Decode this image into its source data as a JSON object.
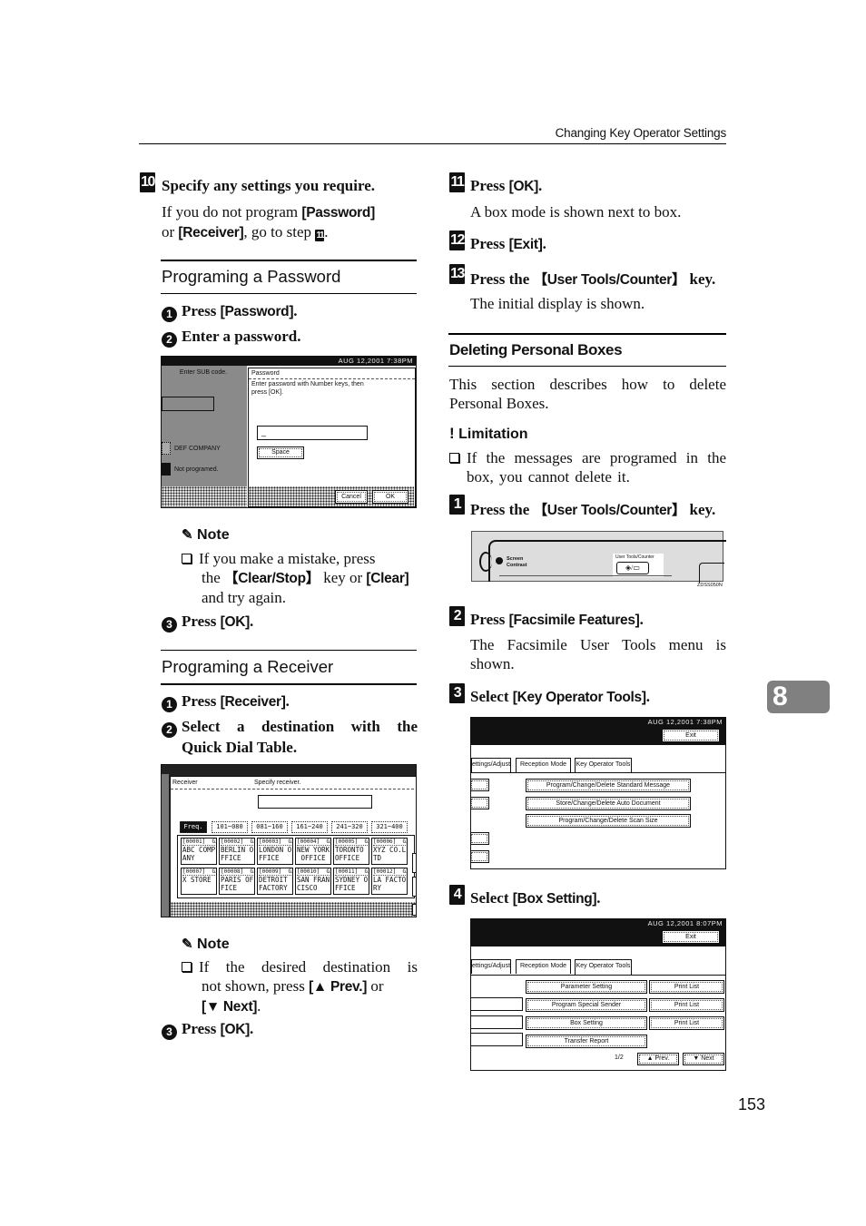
{
  "header": {
    "running_title": "Changing Key Operator Settings"
  },
  "left_column": {
    "step10": {
      "number": "10",
      "title": "Specify any settings you require.",
      "text_pre": "If you do not program ",
      "kw_password": "[Password]",
      "text_or": "or ",
      "kw_receiver": "[Receiver]",
      "text_post": ", go to step ",
      "step_ref": "11",
      "text_end": "."
    },
    "password_section": {
      "title": "Programing a Password",
      "sub1": {
        "num": "1",
        "pre": "Press ",
        "kw": "[Password]",
        "post": "."
      },
      "sub2": {
        "num": "2",
        "text": "Enter a password."
      },
      "screen": {
        "status": "AUG  12,2001  7:38PM",
        "left_label": "Enter SUB code.",
        "item1": "DEF COMPANY",
        "item2": "Not programed.",
        "dialog_title": "Password",
        "dialog_msg1": "Enter password with Number keys, then",
        "dialog_msg2": "press [OK].",
        "input_value": "_",
        "space_button": "Space",
        "cancel_button": "Cancel",
        "ok_button": "OK"
      },
      "note": {
        "title": "Note",
        "line1": "If you make a mistake, press",
        "line2_pre": "the ",
        "kw_clear_stop": "【Clear/Stop】",
        "line2_mid": " key or ",
        "kw_clear": "[Clear]",
        "line3": "and try again."
      },
      "sub3": {
        "num": "3",
        "pre": "Press ",
        "kw": "[OK]",
        "post": "."
      }
    },
    "receiver_section": {
      "title": "Programing a Receiver",
      "sub1": {
        "num": "1",
        "pre": "Press ",
        "kw": "[Receiver]",
        "post": "."
      },
      "sub2": {
        "num": "2",
        "line1": "Select a destination with the",
        "line2": "Quick Dial Table."
      },
      "screen": {
        "title": "Receiver",
        "instruction": "Specify receiver.",
        "tabs": [
          "Freq.",
          "101~080",
          "081~160",
          "161~240",
          "241~320",
          "321~400"
        ],
        "cells": [
          {
            "id": "[00001]  G3",
            "l1": "ABC COMP",
            "l2": "ANY"
          },
          {
            "id": "[00002]  G3",
            "l1": "BERLIN O",
            "l2": "FFICE"
          },
          {
            "id": "[00003]  G3",
            "l1": "LONDON O",
            "l2": "FFICE"
          },
          {
            "id": "[00004]  G3",
            "l1": "NEW YORK",
            "l2": " OFFICE"
          },
          {
            "id": "[00005]  G3",
            "l1": "TORONTO",
            "l2": "OFFICE"
          },
          {
            "id": "[00006]  G3",
            "l1": "XYZ CO.L",
            "l2": "TD"
          },
          {
            "id": "[00007]  G3",
            "l1": "X STORE",
            "l2": ""
          },
          {
            "id": "[00008]  G3",
            "l1": "PARIS OF",
            "l2": "FICE"
          },
          {
            "id": "[00009]  G3",
            "l1": "DETROIT",
            "l2": "FACTORY"
          },
          {
            "id": "[00010]  G3",
            "l1": "SAN FRAN",
            "l2": "CISCO"
          },
          {
            "id": "[00011]  G3",
            "l1": "SYDNEY O",
            "l2": "FFICE"
          },
          {
            "id": "[00012]  G3",
            "l1": "LA FACTO",
            "l2": "RY"
          }
        ]
      },
      "note": {
        "title": "Note",
        "line1": "If the desired destination is",
        "line2_pre": "not shown, press ",
        "kw_prev": "[▲ Prev.]",
        "line2_post": " or",
        "kw_next": "[▼ Next]",
        "line3_post": "."
      },
      "sub3": {
        "num": "3",
        "pre": "Press ",
        "kw": "[OK]",
        "post": "."
      }
    }
  },
  "right_column": {
    "step11": {
      "number": "11",
      "pre": "Press ",
      "kw": "[OK]",
      "post": ".",
      "text": "A box mode is shown next to box."
    },
    "step12": {
      "number": "12",
      "pre": "Press ",
      "kw": "[Exit]",
      "post": "."
    },
    "step13": {
      "number": "13",
      "pre": "Press the ",
      "kw": "【User Tools/Counter】",
      "post": " key.",
      "text": "The initial display is shown."
    },
    "delete_section": {
      "title": "Deleting Personal Boxes",
      "intro": "This section describes how to delete Personal Boxes.",
      "limitation": {
        "title": "Limitation",
        "text": "If the messages are programed in the box, you cannot delete it."
      },
      "step1": {
        "number": "1",
        "pre": "Press the ",
        "kw": "【User Tools/Counter】",
        "post": " key.",
        "panel": {
          "screen_label1": "Screen",
          "screen_label2": "Contrast",
          "key_label": "User Tools/Counter",
          "figure_code": "ZDSS050N"
        }
      },
      "step2": {
        "number": "2",
        "pre": "Press ",
        "kw": "[Facsimile Features]",
        "post": ".",
        "text": "The Facsimile User Tools menu is shown."
      },
      "step3": {
        "number": "3",
        "pre": "Select ",
        "kw": "[Key Operator Tools]",
        "post": ".",
        "screen": {
          "status": "AUG  12,2001  7:38PM",
          "exit_button": "Exit",
          "tabs": [
            "ettings/Adjust",
            "Reception Mode",
            "Key Operator Tools"
          ],
          "buttons": [
            "Program/Change/Delete Standard Message",
            "Store/Change/Delete Auto Document",
            "Program/Change/Delete Scan Size"
          ]
        }
      },
      "step4": {
        "number": "4",
        "pre": "Select ",
        "kw": "[Box Setting]",
        "post": ".",
        "screen": {
          "status": "AUG  12,2001  8:07PM",
          "exit_button": "Exit",
          "tabs": [
            "ettings/Adjust",
            "Reception Mode",
            "Key Operator Tools"
          ],
          "rows": [
            {
              "label": "Parameter Setting",
              "print": "Print List"
            },
            {
              "label": "Program Special Sender",
              "print": "Print List"
            },
            {
              "label": "Box Setting",
              "print": "Print List"
            },
            {
              "label": "Transfer Report",
              "print": ""
            }
          ],
          "page_indicator": "1/2",
          "prev_button": "▲ Prev.",
          "next_button": "▼ Next"
        }
      }
    }
  },
  "chapter_tab": "8",
  "page_number": "153"
}
